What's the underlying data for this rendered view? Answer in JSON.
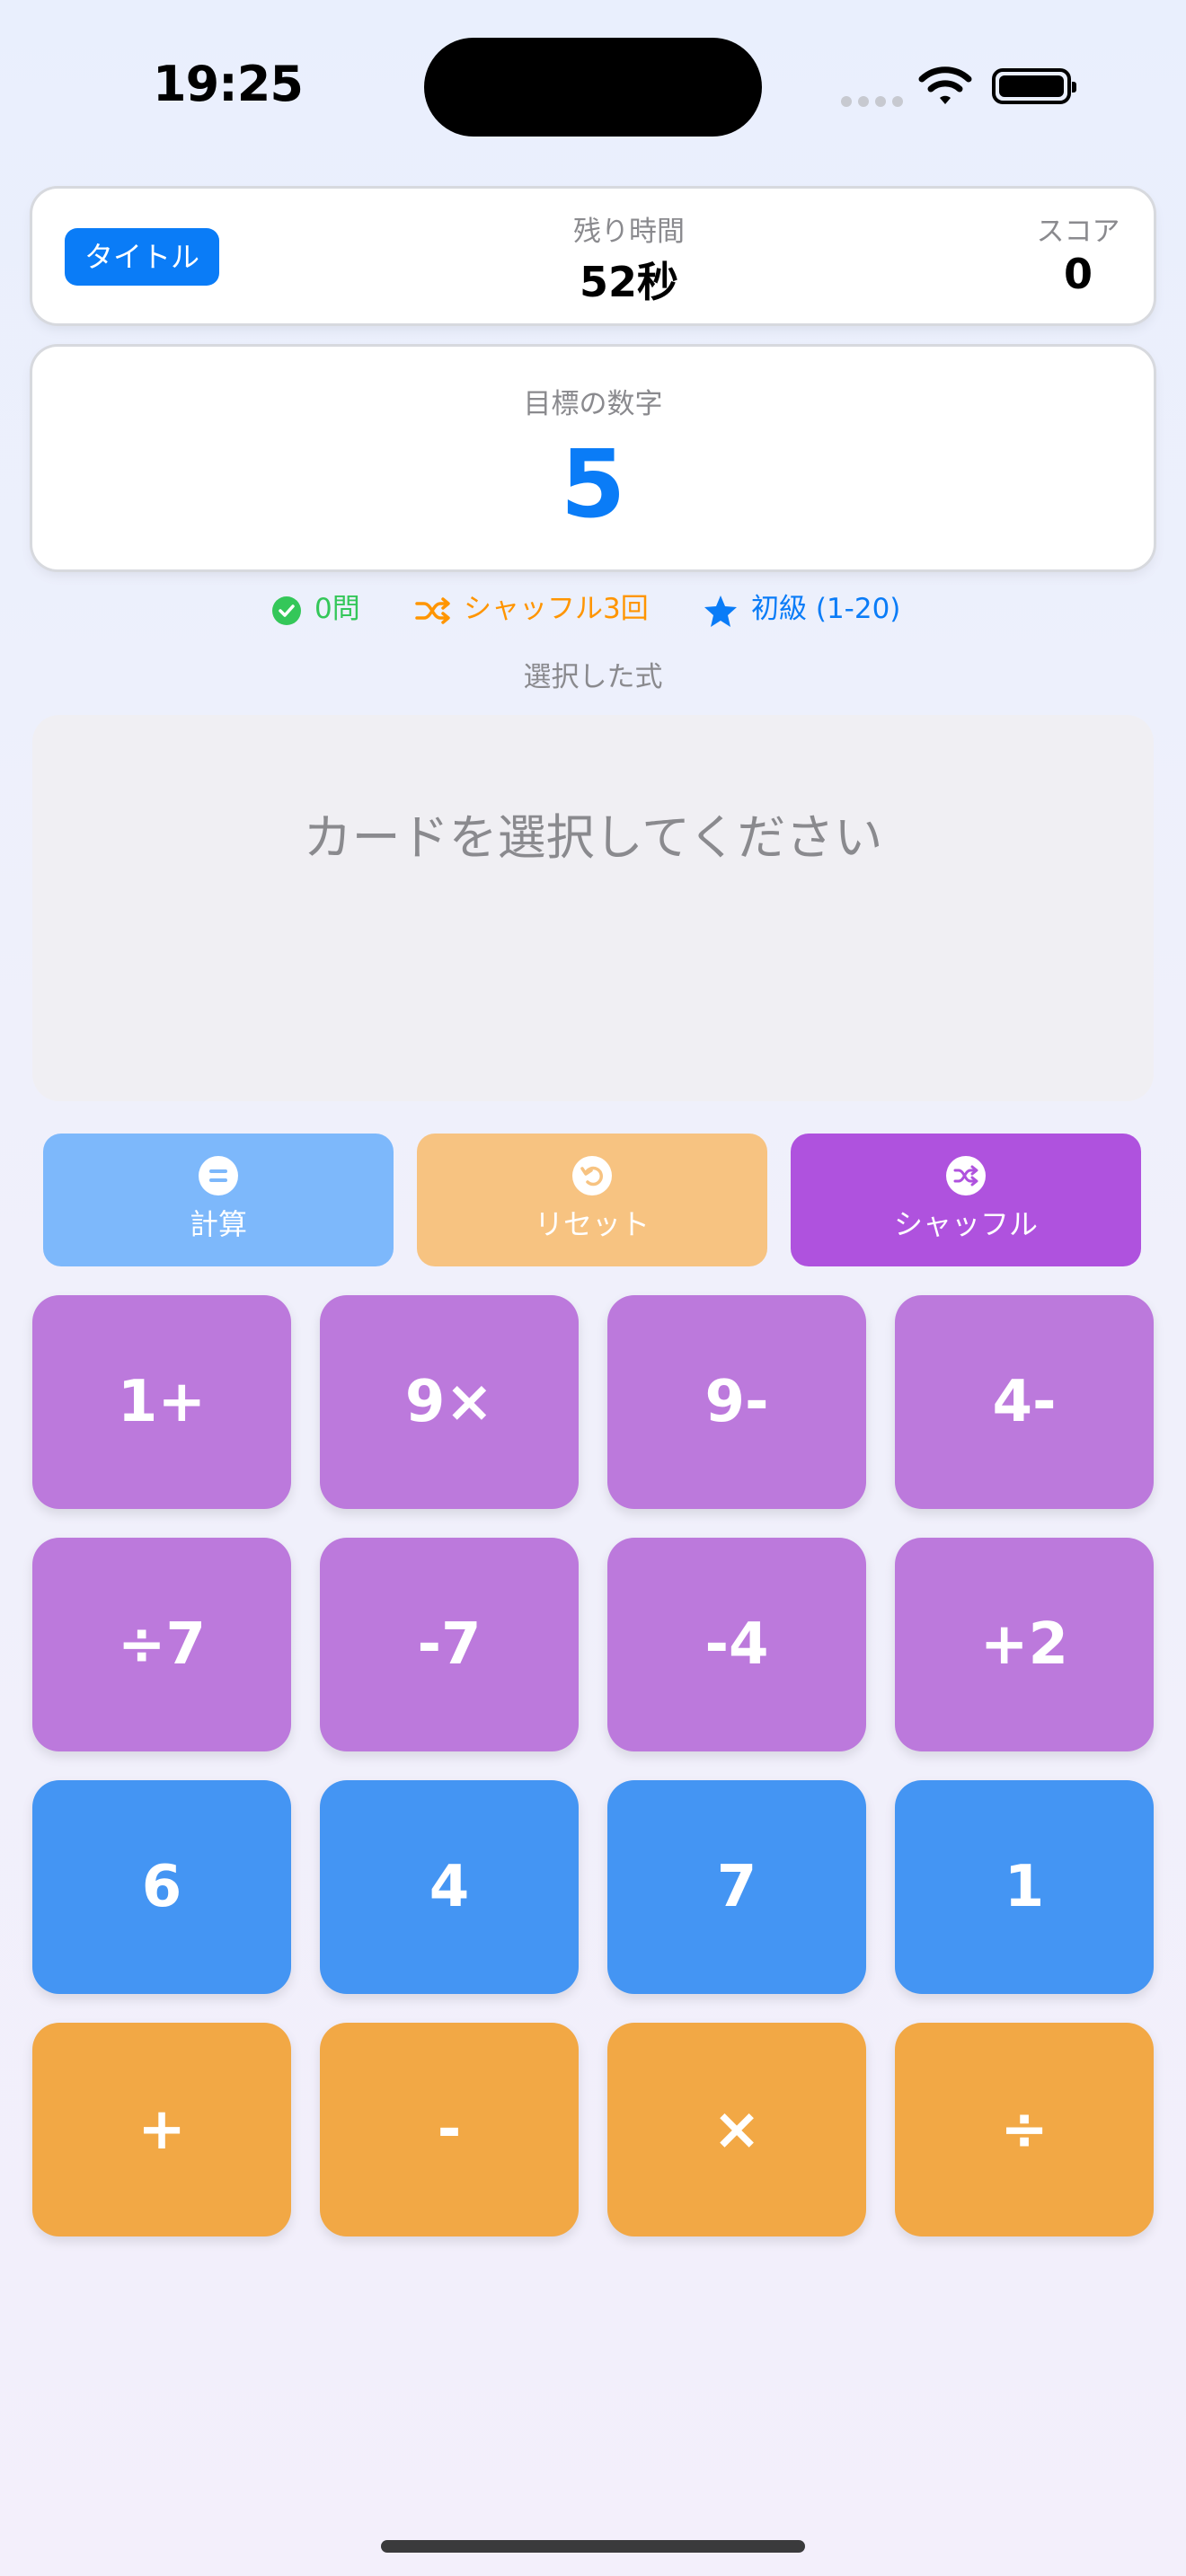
{
  "status_bar": {
    "time": "19:25"
  },
  "header": {
    "title_button": "タイトル",
    "time_label": "残り時間",
    "time_value": "52秒",
    "score_label": "スコア",
    "score_value": "0"
  },
  "target": {
    "label": "目標の数字",
    "value": "5"
  },
  "info": {
    "solved": "0問",
    "shuffles": "シャッフル3回",
    "level": "初級 (1-20)"
  },
  "expression": {
    "label": "選択した式",
    "placeholder": "カードを選択してください"
  },
  "actions": {
    "calculate": "計算",
    "reset": "リセット",
    "shuffle": "シャッフル"
  },
  "tiles": {
    "operation_cards": [
      "1+",
      "9×",
      "9-",
      "4-",
      "÷7",
      "-7",
      "-4",
      "+2"
    ],
    "number_cards": [
      "6",
      "4",
      "7",
      "1"
    ],
    "operators": [
      "+",
      "-",
      "×",
      "÷"
    ]
  },
  "colors": {
    "accent": "#0a7cf7",
    "solved": "#34c759",
    "shuffle_text": "#ff9500",
    "calc_button": "#7db8fb",
    "reset_button": "#f7c381",
    "shuffle_button": "#af52de",
    "operation_card": "#bc79dc",
    "number_card": "#4495f3",
    "operator_card": "#f2a845"
  }
}
